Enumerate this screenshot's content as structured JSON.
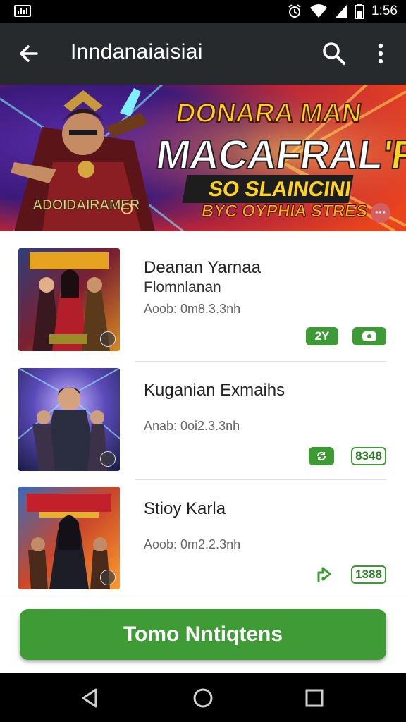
{
  "status_bar": {
    "time": "1:56"
  },
  "app_bar": {
    "title": "Inndanaiaisiai"
  },
  "banner": {
    "line1": "DONARA MAN",
    "line2_main": "MACAFRAL",
    "line2_accent": "'R",
    "line3": "SO SLAINCINI",
    "line4": "BYC OYPHIA STRES",
    "logo": "ADOIDAIRAMER"
  },
  "items": [
    {
      "title": "Deanan Yarnaa",
      "subtitle": "Flomnlanan",
      "meta": "Aoob: 0m8.3.3nh",
      "chips": [
        {
          "label": "2Y",
          "style": "solid"
        },
        {
          "label": "",
          "style": "solid",
          "icon": "dice-icon"
        }
      ]
    },
    {
      "title": "Kuganian Exmaihs",
      "subtitle": "",
      "meta": "Anab: 0oi2.3.3nh",
      "chips": [
        {
          "label": "",
          "style": "solid",
          "icon": "refresh-icon"
        },
        {
          "label": "8348",
          "style": "outline"
        }
      ]
    },
    {
      "title": "Stioy Karla",
      "subtitle": "",
      "meta": "Aoob: 0m2.2.3nh",
      "chips": [
        {
          "label": "",
          "style": "none",
          "icon": "share-icon"
        },
        {
          "label": "1388",
          "style": "outline"
        }
      ]
    }
  ],
  "cta": {
    "label": "Tomo Nntiqtens"
  },
  "colors": {
    "accent_green": "#3e9b35",
    "app_bar": "#262a2d"
  }
}
